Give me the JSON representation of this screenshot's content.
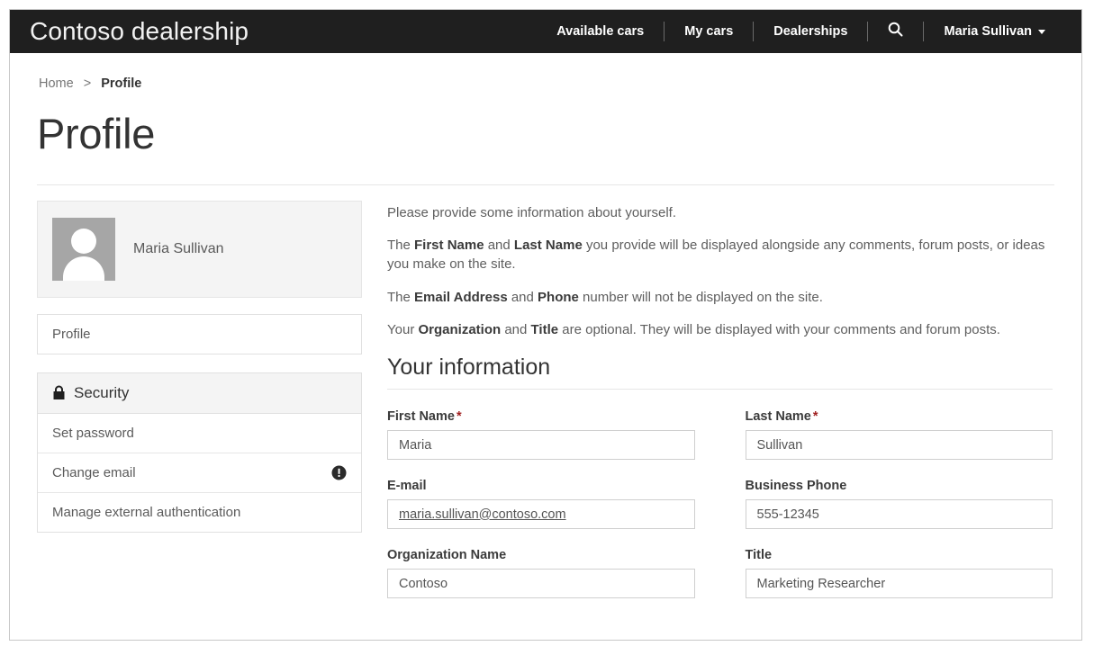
{
  "header": {
    "brand": "Contoso dealership",
    "nav": [
      {
        "label": "Available cars",
        "name": "nav-available-cars"
      },
      {
        "label": "My cars",
        "name": "nav-my-cars"
      },
      {
        "label": "Dealerships",
        "name": "nav-dealerships"
      }
    ],
    "search_icon": "search-icon",
    "user": {
      "name": "Maria Sullivan",
      "caret_icon": "chevron-down-icon"
    }
  },
  "breadcrumb": {
    "home": "Home",
    "separator": ">",
    "current": "Profile"
  },
  "page": {
    "title": "Profile"
  },
  "sidebar": {
    "profile_card": {
      "avatar_icon": "user-avatar-icon",
      "name": "Maria Sullivan"
    },
    "profile_nav": [
      {
        "label": "Profile",
        "name": "sidebar-item-profile"
      }
    ],
    "security": {
      "lock_icon": "lock-icon",
      "header": "Security",
      "items": [
        {
          "label": "Set password",
          "name": "sidebar-item-set-password",
          "badge": null
        },
        {
          "label": "Change email",
          "name": "sidebar-item-change-email",
          "badge": "alert-exclamation-icon"
        },
        {
          "label": "Manage external authentication",
          "name": "sidebar-item-manage-external-authentication",
          "badge": null
        }
      ]
    }
  },
  "main": {
    "intro": {
      "p1": "Please provide some information about yourself.",
      "p2_a": "The ",
      "p2_b1": "First Name",
      "p2_c": " and ",
      "p2_b2": "Last Name",
      "p2_d": " you provide will be displayed alongside any comments, forum posts, or ideas you make on the site.",
      "p3_a": "The ",
      "p3_b1": "Email Address",
      "p3_c": " and ",
      "p3_b2": "Phone",
      "p3_d": " number will not be displayed on the site.",
      "p4_a": "Your ",
      "p4_b1": "Organization",
      "p4_c": " and ",
      "p4_b2": "Title",
      "p4_d": " are optional. They will be displayed with your comments and forum posts."
    },
    "section_heading": "Your information",
    "fields": {
      "first_name": {
        "label": "First Name",
        "required_marker": "*",
        "value": "Maria"
      },
      "last_name": {
        "label": "Last Name",
        "required_marker": "*",
        "value": "Sullivan"
      },
      "email": {
        "label": "E-mail",
        "value": "maria.sullivan@contoso.com"
      },
      "business_phone": {
        "label": "Business Phone",
        "value": "555-12345"
      },
      "organization_name": {
        "label": "Organization Name",
        "value": "Contoso"
      },
      "title": {
        "label": "Title",
        "value": "Marketing Researcher"
      }
    }
  },
  "colors": {
    "topbar_bg": "#1f1f1f",
    "panel_bg": "#f4f4f4",
    "border": "#e0e0e0",
    "required_star": "#a02020",
    "text_muted": "#5e5e5e"
  }
}
